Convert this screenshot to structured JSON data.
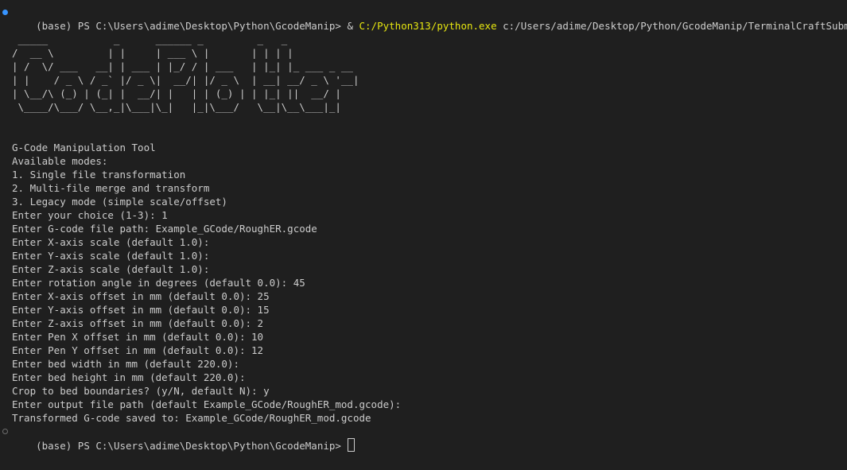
{
  "colors": {
    "background": "#1f1f1f",
    "text": "#cccccc",
    "highlight": "#e5e510",
    "status_dot": "#3794ff",
    "status_dot_hollow": "#6e6e6e"
  },
  "command": {
    "prompt": "(base) PS C:\\Users\\adime\\Desktop\\Python\\GcodeManip> ",
    "operator": "& ",
    "executable": "C:/Python313/python.exe",
    "argument": " c:/Users/adime/Desktop/Python/GcodeManip/TerminalCraftSubmission.py"
  },
  "banner": {
    "ascii_art": " _____           _      ______ _         _   _\n/  __ \\         | |     | ___ \\ |       | | | |\n| /  \\/ ___   __| | ___ | |_/ / | ___   | |_| |_ ___ _ __\n| |    / _ \\ / _` |/ _ \\|  __/| |/ _ \\  | __| __/ _ \\ '__|\n| \\__/\\ (_) | (_| |  __/| |   | | (_) | | |_| ||  __/ |\n \\____/\\___/ \\__,_|\\___|\\_|   |_|\\___/   \\__|\\__\\___|_|"
  },
  "output_lines": [
    "G-Code Manipulation Tool",
    "Available modes:",
    "1. Single file transformation",
    "2. Multi-file merge and transform",
    "3. Legacy mode (simple scale/offset)",
    "Enter your choice (1-3): 1",
    "Enter G-code file path: Example_GCode/RoughER.gcode",
    "Enter X-axis scale (default 1.0):",
    "Enter Y-axis scale (default 1.0):",
    "Enter Z-axis scale (default 1.0):",
    "Enter rotation angle in degrees (default 0.0): 45",
    "Enter X-axis offset in mm (default 0.0): 25",
    "Enter Y-axis offset in mm (default 0.0): 15",
    "Enter Z-axis offset in mm (default 0.0): 2",
    "Enter Pen X offset in mm (default 0.0): 10",
    "Enter Pen Y offset in mm (default 0.0): 12",
    "Enter bed width in mm (default 220.0):",
    "Enter bed height in mm (default 220.0):",
    "Crop to bed boundaries? (y/N, default N): y",
    "Enter output file path (default Example_GCode/RoughER_mod.gcode):",
    "Transformed G-code saved to: Example_GCode/RoughER_mod.gcode"
  ],
  "final_prompt": "(base) PS C:\\Users\\adime\\Desktop\\Python\\GcodeManip> "
}
